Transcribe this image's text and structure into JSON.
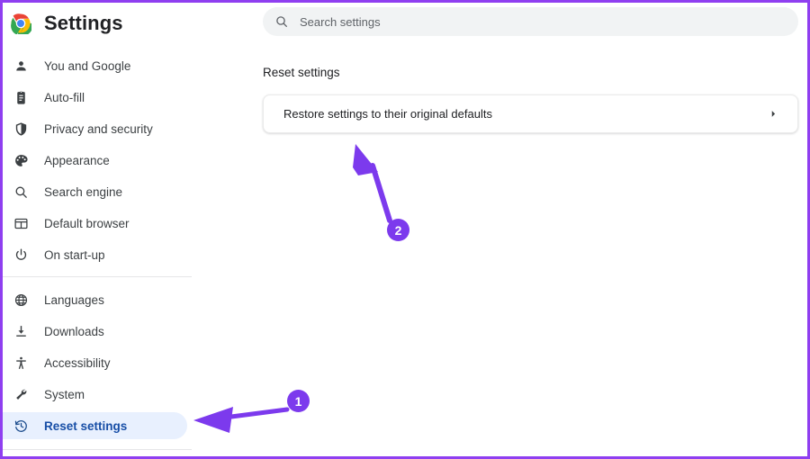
{
  "window": {
    "border_color": "#8f3ff0",
    "background": "#ffffff"
  },
  "sidebar": {
    "logo_icon": "chrome-logo-icon",
    "title": "Settings",
    "groups": [
      {
        "items": [
          {
            "label": "You and Google",
            "icon": "person-icon",
            "active": false
          },
          {
            "label": "Auto-fill",
            "icon": "clipboard-icon",
            "active": false
          },
          {
            "label": "Privacy and security",
            "icon": "shield-check-icon",
            "active": false
          },
          {
            "label": "Appearance",
            "icon": "palette-icon",
            "active": false
          },
          {
            "label": "Search engine",
            "icon": "magnifier-icon",
            "active": false
          },
          {
            "label": "Default browser",
            "icon": "browser-window-icon",
            "active": false
          },
          {
            "label": "On start-up",
            "icon": "power-icon",
            "active": false
          }
        ]
      },
      {
        "items": [
          {
            "label": "Languages",
            "icon": "globe-icon",
            "active": false
          },
          {
            "label": "Downloads",
            "icon": "download-icon",
            "active": false
          },
          {
            "label": "Accessibility",
            "icon": "accessibility-icon",
            "active": false
          },
          {
            "label": "System",
            "icon": "wrench-icon",
            "active": false
          },
          {
            "label": "Reset settings",
            "icon": "history-restore-icon",
            "active": true
          }
        ]
      }
    ],
    "active_item_label": "Reset settings",
    "active_background": "#e8f0fe",
    "active_text_color": "#174ea6"
  },
  "search": {
    "icon": "search-icon",
    "placeholder": "Search settings",
    "value": ""
  },
  "main": {
    "section_title": "Reset settings",
    "card": {
      "row_label": "Restore settings to their original defaults",
      "chevron_icon": "chevron-right-icon"
    }
  },
  "annotations": {
    "color": "#7c3aed",
    "markers": [
      {
        "number": "1",
        "points_at": "Reset settings sidebar item"
      },
      {
        "number": "2",
        "points_at": "Restore settings to their original defaults row"
      }
    ]
  }
}
